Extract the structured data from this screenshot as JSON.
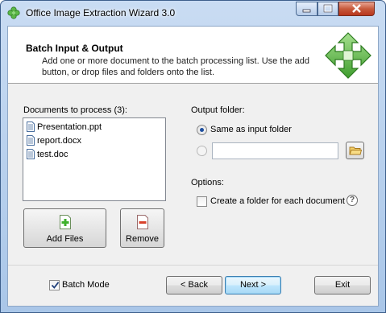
{
  "window": {
    "title": "Office Image Extraction Wizard 3.0"
  },
  "header": {
    "title": "Batch Input & Output",
    "description": "Add one or more document to the batch processing list. Use the add button, or drop files and folders onto the list."
  },
  "documents": {
    "label": "Documents to process (3):",
    "items": [
      {
        "name": "Presentation.ppt"
      },
      {
        "name": "report.docx"
      },
      {
        "name": "test.doc"
      }
    ],
    "add_label": "Add Files",
    "remove_label": "Remove"
  },
  "output": {
    "label": "Output folder:",
    "same_as_input_label": "Same as input folder",
    "same_as_input_selected": true,
    "custom_path": ""
  },
  "options": {
    "label": "Options:",
    "create_folder_label": "Create a folder for each document",
    "create_folder_checked": false
  },
  "footer": {
    "batch_mode_label": "Batch Mode",
    "batch_mode_checked": true,
    "back_label": "< Back",
    "next_label": "Next >",
    "exit_label": "Exit"
  },
  "colors": {
    "title_bar": "#b4cde9",
    "close_button": "#c75a3c",
    "accent_green": "#4caf3a"
  },
  "icons": {
    "app": "green-clover-icon",
    "header": "green-four-arrows-icon",
    "document": "document-icon",
    "add": "add-file-icon",
    "remove": "remove-file-icon",
    "folder": "folder-icon",
    "help": "question-mark-icon"
  }
}
